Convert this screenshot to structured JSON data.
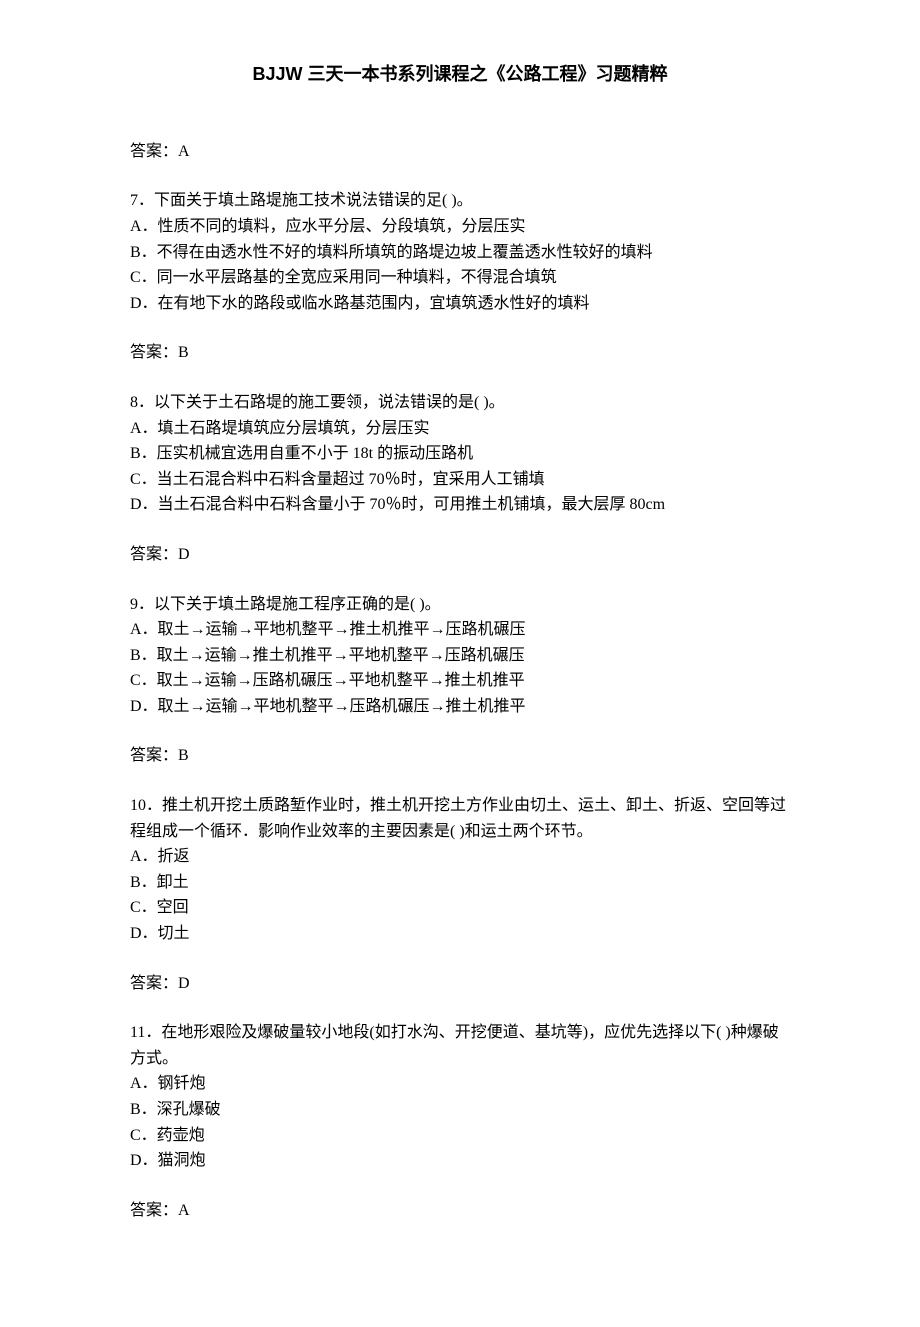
{
  "header": {
    "title": "BJJW 三天一本书系列课程之《公路工程》习题精粹"
  },
  "blocks": [
    {
      "lines": [
        "答案：A"
      ]
    },
    {
      "lines": [
        "7．下面关于填土路堤施工技术说法错误的足( )。",
        "A．性质不同的填料，应水平分层、分段填筑，分层压实",
        "B．不得在由透水性不好的填料所填筑的路堤边坡上覆盖透水性较好的填料",
        "C．同一水平层路基的全宽应采用同一种填料，不得混合填筑",
        "D．在有地下水的路段或临水路基范围内，宜填筑透水性好的填料"
      ]
    },
    {
      "lines": [
        "答案：B"
      ]
    },
    {
      "lines": [
        "8．以下关于土石路堤的施工要领，说法错误的是( )。",
        "A．填土石路堤填筑应分层填筑，分层压实",
        "B．压实机械宜选用自重不小于 18t 的振动压路机",
        "C．当土石混合料中石料含量超过 70％时，宜采用人工铺填",
        "D．当土石混合料中石料含量小于 70％时，可用推土机铺填，最大层厚 80cm"
      ]
    },
    {
      "lines": [
        "答案：D"
      ]
    },
    {
      "lines": [
        "9．以下关于填土路堤施工程序正确的是( )。",
        "A．取土→运输→平地机整平→推土机推平→压路机碾压",
        "B．取土→运输→推土机推平→平地机整平→压路机碾压",
        "C．取土→运输→压路机碾压→平地机整平→推土机推平",
        "D．取土→运输→平地机整平→压路机碾压→推土机推平"
      ]
    },
    {
      "lines": [
        "答案：B"
      ]
    },
    {
      "lines": [
        "10．推土机开挖土质路堑作业时，推土机开挖土方作业由切土、运土、卸土、折返、空回等过程组成一个循环．影响作业效率的主要因素是( )和运土两个环节。",
        "A．折返",
        "B．卸土",
        "C．空回",
        "D．切土"
      ]
    },
    {
      "lines": [
        "答案：D"
      ]
    },
    {
      "lines": [
        "11．在地形艰险及爆破量较小地段(如打水沟、开挖便道、基坑等)，应优先选择以下( )种爆破方式。",
        "A．钢钎炮",
        "B．深孔爆破",
        "C．药壶炮",
        "D．猫洞炮"
      ]
    },
    {
      "lines": [
        "答案：A"
      ]
    }
  ]
}
